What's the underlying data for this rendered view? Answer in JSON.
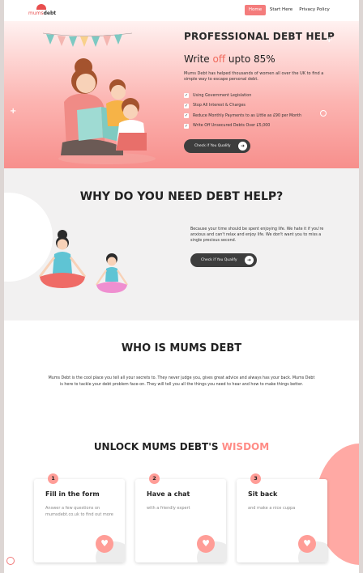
{
  "brand": {
    "name_part1": "mums",
    "name_part2": "debt"
  },
  "nav": {
    "items": [
      {
        "label": "Home",
        "active": true
      },
      {
        "label": "Start Here",
        "active": false
      },
      {
        "label": "Privacy Policy",
        "active": false
      }
    ]
  },
  "hero": {
    "title": "PROFESSIONAL DEBT HELP",
    "subtitle_pre": "Write ",
    "subtitle_accent": "off",
    "subtitle_post": " upto 85%",
    "description": "Mums Debt has helped thousands of women all over the UK to find a simple way to escape personal debt.",
    "checklist": [
      "Using Government Legislation",
      "Stop All Interest & Charges",
      "Reduce Monthly Payments to as Little as £90 per Month",
      "Write Off Unsecured Debts Over £5,000"
    ],
    "cta_label": "Check if You Qualify"
  },
  "why": {
    "title": "WHY DO YOU NEED DEBT HELP?",
    "description": "Because your time should be spent enjoying life. We hate it if you're anxious and can't relax and enjoy life. We don't want you to miss a single precious second.",
    "cta_label": "Check if You Qualify"
  },
  "who": {
    "title": "WHO IS MUMS DEBT",
    "description": "Mums Debt is the cool place you tell all your secrets to. They never judge you, gives great advice and always has your back. Mums Debt is here to tackle your debt problem face-on. They will tell you all the things you need to hear and how to make things better."
  },
  "wisdom": {
    "title_pre": "UNLOCK MUMS DEBT'S ",
    "title_highlight": "WISDOM",
    "steps": [
      {
        "number": "1",
        "title": "Fill in the form",
        "desc": "Answer a few questions on mumsdebt.co.uk to find out more"
      },
      {
        "number": "2",
        "title": "Have a chat",
        "desc": "with a friendly expert"
      },
      {
        "number": "3",
        "title": "Sit back",
        "desc": "and make a nice cuppa"
      }
    ]
  },
  "colors": {
    "accent": "#f47c7c",
    "dark_button": "#3d3d3d",
    "hero_gradient_end": "#f78f8c",
    "highlight": "#ff8c86"
  },
  "icons": {
    "check": "check-icon",
    "arrow": "arrow-right-icon",
    "heart": "heart-icon"
  }
}
